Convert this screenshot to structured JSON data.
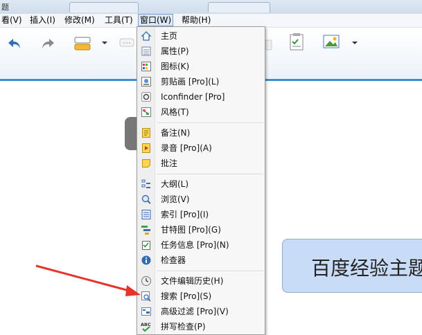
{
  "window": {
    "title_fragment": "题"
  },
  "menubar": {
    "items": [
      "看(V)",
      "插入(I)",
      "修改(M)",
      "工具(T)",
      "窗口(W)",
      "帮助(H)"
    ]
  },
  "window_menu": {
    "items": [
      {
        "label": "主页",
        "icon": "home-icon"
      },
      {
        "label": "属性(P)",
        "icon": "properties-icon"
      },
      {
        "label": "图标(K)",
        "icon": "icons-panel-icon"
      },
      {
        "label": "剪贴画 [Pro](L)",
        "icon": "clipart-icon"
      },
      {
        "label": "Iconfinder [Pro]",
        "icon": "iconfinder-icon"
      },
      {
        "label": "风格(T)",
        "icon": "style-icon"
      },
      {
        "label": "备注(N)",
        "icon": "notes-icon"
      },
      {
        "label": "录音 [Pro](A)",
        "icon": "audio-icon"
      },
      {
        "label": "批注",
        "icon": "comment-icon"
      },
      {
        "label": "大纲(L)",
        "icon": "outline-icon"
      },
      {
        "label": "浏览(V)",
        "icon": "navigator-icon"
      },
      {
        "label": "索引 [Pro](I)",
        "icon": "index-icon"
      },
      {
        "label": "甘特图 [Pro](G)",
        "icon": "gantt-icon"
      },
      {
        "label": "任务信息 [Pro](N)",
        "icon": "task-info-icon"
      },
      {
        "label": "检查器",
        "icon": "info-icon"
      },
      {
        "label": "文件编辑历史(H)",
        "icon": "history-clock-icon"
      },
      {
        "label": "搜索 [Pro](S)",
        "icon": "search-icon"
      },
      {
        "label": "高级过滤 [Pro](V)",
        "icon": "filter-icon"
      },
      {
        "label": "拼写检查(P)",
        "icon": "spellcheck-icon"
      }
    ]
  },
  "canvas": {
    "topic_text": "百度经验主题"
  },
  "colors": {
    "accent": "#3d8ec9",
    "arrow": "#e8332a",
    "topic_fill": "#c9dcf7"
  }
}
